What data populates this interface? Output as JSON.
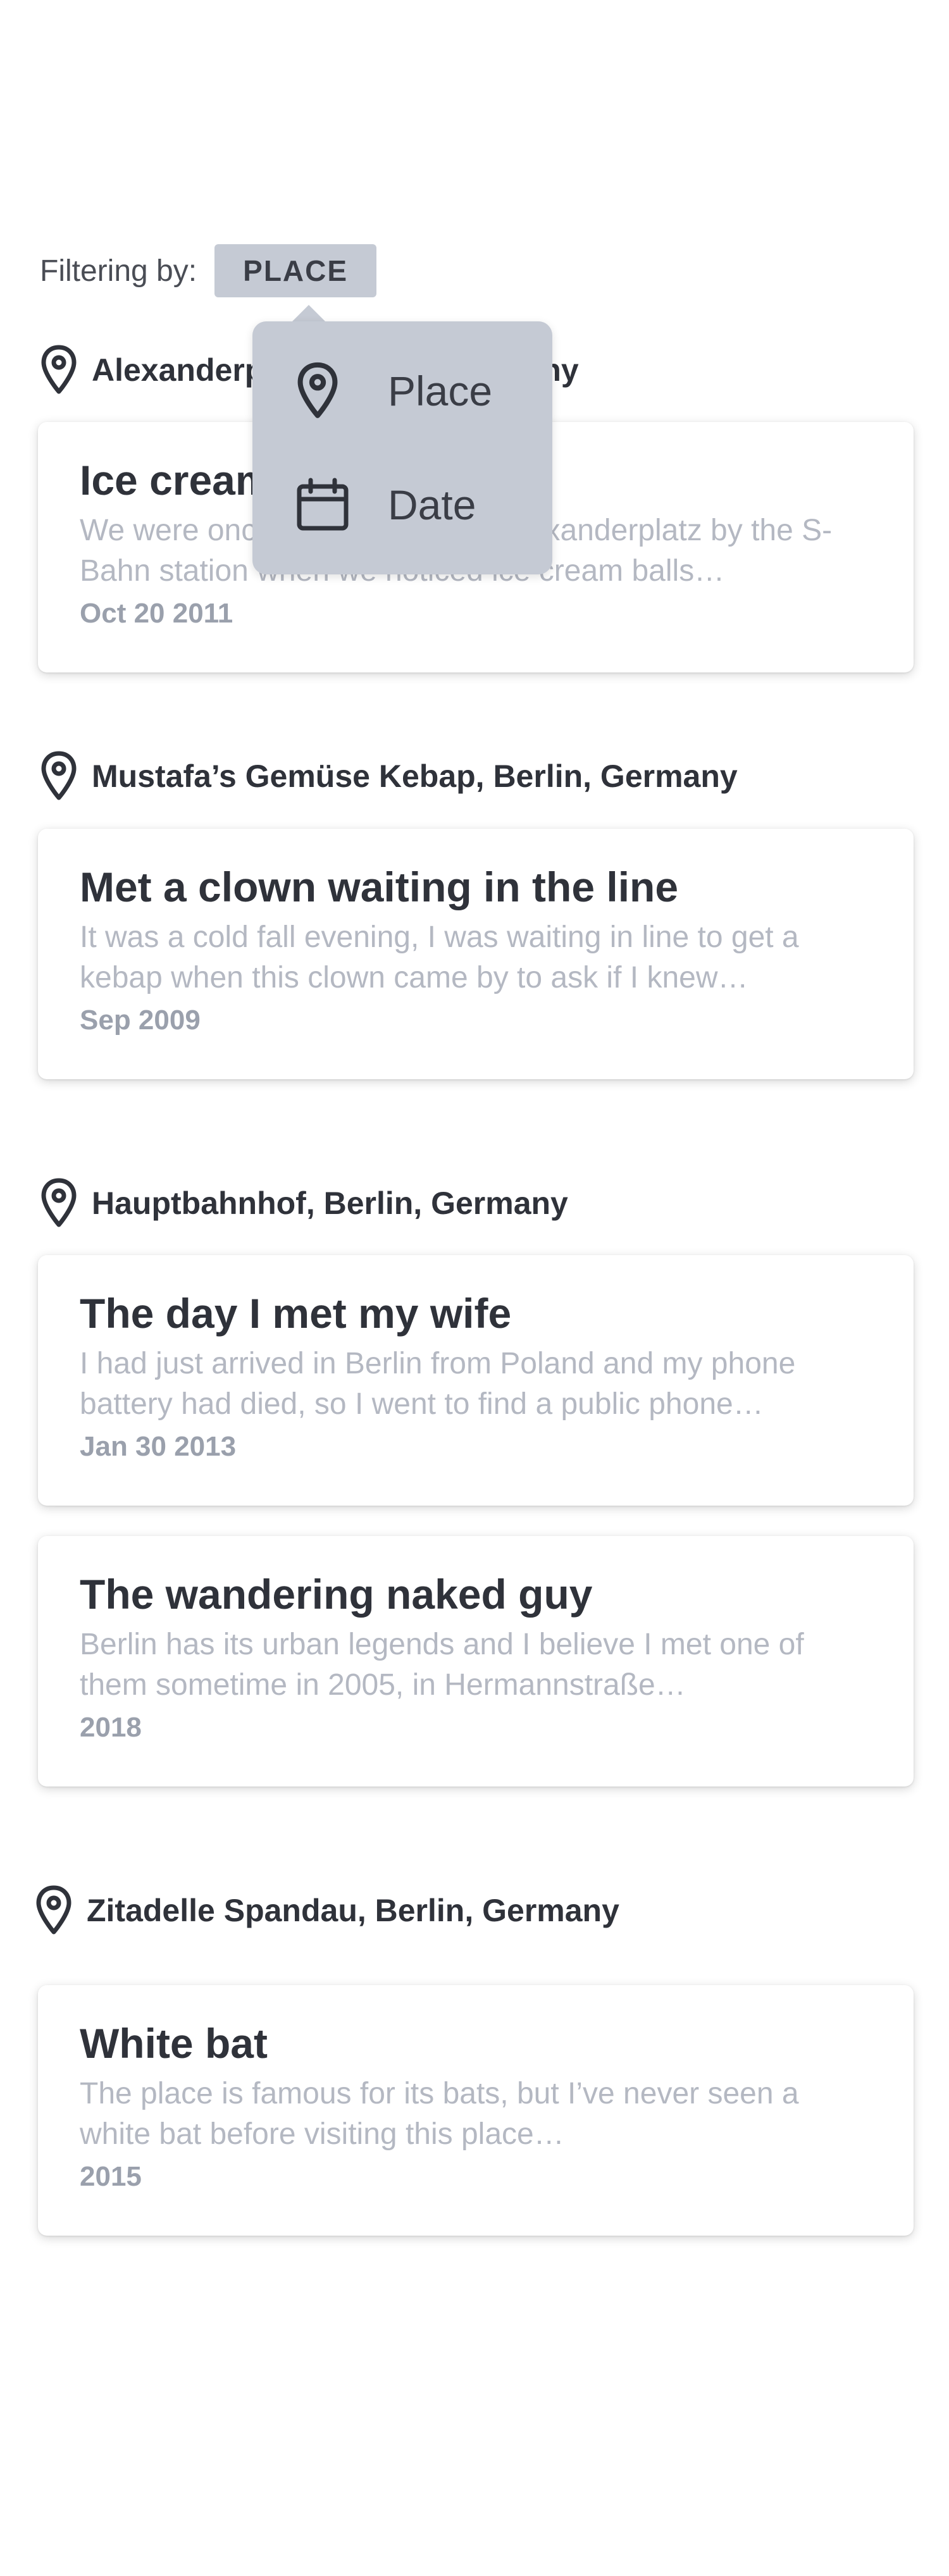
{
  "filter": {
    "label": "Filtering by:",
    "selected": "PLACE"
  },
  "dropdown": {
    "options": [
      {
        "label": "Place",
        "icon": "pin-icon"
      },
      {
        "label": "Date",
        "icon": "calendar-icon"
      }
    ]
  },
  "groups": [
    {
      "location": "Alexanderplatz, Berlin, Germany",
      "stories": [
        {
          "title": "Ice cream balls",
          "excerpt": "We were once walking through Alexanderplatz by the S-Bahn station when we noticed ice cream balls…",
          "date": "Oct 20 2011"
        }
      ]
    },
    {
      "location": "Mustafa’s Gemüse Kebap, Berlin, Germany",
      "stories": [
        {
          "title": "Met a clown waiting in the line",
          "excerpt": "It was a cold fall evening, I was waiting in line to get a kebap when this clown came by to ask if I knew…",
          "date": "Sep 2009"
        }
      ]
    },
    {
      "location": "Hauptbahnhof, Berlin, Germany",
      "stories": [
        {
          "title": "The day I met my wife",
          "excerpt": "I had just arrived in Berlin from Poland and my phone battery had died, so I went to find a public phone…",
          "date": "Jan 30 2013"
        },
        {
          "title": "The wandering naked guy",
          "excerpt": "Berlin has its urban legends and I believe I met one of them sometime in 2005, in Hermannstraße…",
          "date": "2018"
        }
      ]
    },
    {
      "location": "Zitadelle Spandau, Berlin, Germany",
      "stories": [
        {
          "title": "White bat",
          "excerpt": "The place is famous for its bats, but I’ve never seen a white bat before visiting this place…",
          "date": "2015"
        }
      ]
    }
  ]
}
